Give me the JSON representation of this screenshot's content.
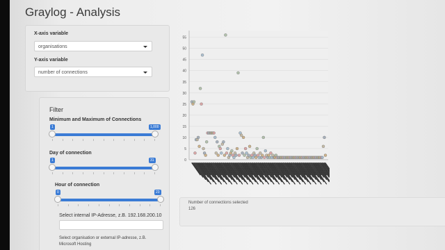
{
  "app": {
    "title": "Graylog - Analysis"
  },
  "axes_panel": {
    "x_label": "X-axis variable",
    "x_value": "organisations",
    "y_label": "Y-axis variable",
    "y_value": "number of connections"
  },
  "filter": {
    "heading": "Filter",
    "connections": {
      "label": "Minimum and Maximum of Connections",
      "min_badge": "1",
      "max_badge": "1,000",
      "min_fraction": 0.0,
      "max_fraction": 1.0
    },
    "day": {
      "label": "Day of connection",
      "min_badge": "1",
      "max_badge": "31",
      "min_fraction": 0.0,
      "max_fraction": 1.0
    },
    "hour": {
      "label": "Hour of connection",
      "min_badge": "0",
      "max_badge": "23",
      "min_fraction": 0.0,
      "max_fraction": 1.0
    },
    "ip_label": "Select internal IP-Adresse, z.B. 192.168.200.10",
    "org_label": "Select organisation or external IP-adresse, z.B. Microsoft Hosting"
  },
  "summary": {
    "label": "Number of connections selected",
    "count": "126"
  },
  "chart_data": {
    "type": "scatter",
    "ylim": [
      0,
      58
    ],
    "yticks": [
      "0",
      "5",
      "10",
      "15",
      "20",
      "25",
      "30",
      "35",
      "40",
      "45",
      "50",
      "55"
    ],
    "grid": true,
    "points": [
      {
        "x": 1,
        "y": 26
      },
      {
        "x": 2,
        "y": 25
      },
      {
        "x": 3,
        "y": 26
      },
      {
        "x": 2,
        "y": 3
      },
      {
        "x": 4,
        "y": 9
      },
      {
        "x": 5,
        "y": 9
      },
      {
        "x": 6,
        "y": 10
      },
      {
        "x": 7,
        "y": 6
      },
      {
        "x": 8,
        "y": 32
      },
      {
        "x": 8,
        "y": 25
      },
      {
        "x": 9,
        "y": 47
      },
      {
        "x": 10,
        "y": 5
      },
      {
        "x": 11,
        "y": 3
      },
      {
        "x": 12,
        "y": 2
      },
      {
        "x": 13,
        "y": 8
      },
      {
        "x": 14,
        "y": 12
      },
      {
        "x": 15,
        "y": 12
      },
      {
        "x": 16,
        "y": 12
      },
      {
        "x": 17,
        "y": 12
      },
      {
        "x": 18,
        "y": 12
      },
      {
        "x": 19,
        "y": 12
      },
      {
        "x": 20,
        "y": 12
      },
      {
        "x": 21,
        "y": 10
      },
      {
        "x": 22,
        "y": 3
      },
      {
        "x": 23,
        "y": 8
      },
      {
        "x": 24,
        "y": 2
      },
      {
        "x": 25,
        "y": 6
      },
      {
        "x": 26,
        "y": 5
      },
      {
        "x": 27,
        "y": 3
      },
      {
        "x": 28,
        "y": 7
      },
      {
        "x": 29,
        "y": 8
      },
      {
        "x": 30,
        "y": 2
      },
      {
        "x": 31,
        "y": 56
      },
      {
        "x": 32,
        "y": 3
      },
      {
        "x": 33,
        "y": 5
      },
      {
        "x": 34,
        "y": 1
      },
      {
        "x": 35,
        "y": 2
      },
      {
        "x": 36,
        "y": 3
      },
      {
        "x": 37,
        "y": 4
      },
      {
        "x": 38,
        "y": 2
      },
      {
        "x": 39,
        "y": 1
      },
      {
        "x": 40,
        "y": 3
      },
      {
        "x": 41,
        "y": 2
      },
      {
        "x": 42,
        "y": 5
      },
      {
        "x": 43,
        "y": 39
      },
      {
        "x": 44,
        "y": 2
      },
      {
        "x": 45,
        "y": 12
      },
      {
        "x": 46,
        "y": 11
      },
      {
        "x": 47,
        "y": 3
      },
      {
        "x": 48,
        "y": 10
      },
      {
        "x": 49,
        "y": 2
      },
      {
        "x": 50,
        "y": 5
      },
      {
        "x": 51,
        "y": 3
      },
      {
        "x": 52,
        "y": 1
      },
      {
        "x": 53,
        "y": 2
      },
      {
        "x": 54,
        "y": 6
      },
      {
        "x": 55,
        "y": 1
      },
      {
        "x": 56,
        "y": 2
      },
      {
        "x": 57,
        "y": 1
      },
      {
        "x": 58,
        "y": 3
      },
      {
        "x": 59,
        "y": 2
      },
      {
        "x": 60,
        "y": 1
      },
      {
        "x": 61,
        "y": 5
      },
      {
        "x": 62,
        "y": 2
      },
      {
        "x": 63,
        "y": 1
      },
      {
        "x": 64,
        "y": 3
      },
      {
        "x": 65,
        "y": 1
      },
      {
        "x": 66,
        "y": 2
      },
      {
        "x": 67,
        "y": 10
      },
      {
        "x": 68,
        "y": 1
      },
      {
        "x": 69,
        "y": 4
      },
      {
        "x": 70,
        "y": 2
      },
      {
        "x": 71,
        "y": 1
      },
      {
        "x": 72,
        "y": 2
      },
      {
        "x": 73,
        "y": 1
      },
      {
        "x": 74,
        "y": 3
      },
      {
        "x": 75,
        "y": 1
      },
      {
        "x": 76,
        "y": 2
      },
      {
        "x": 77,
        "y": 1
      },
      {
        "x": 78,
        "y": 1
      },
      {
        "x": 79,
        "y": 2
      },
      {
        "x": 80,
        "y": 1
      },
      {
        "x": 81,
        "y": 1
      },
      {
        "x": 82,
        "y": 1
      },
      {
        "x": 83,
        "y": 1
      },
      {
        "x": 84,
        "y": 1
      },
      {
        "x": 85,
        "y": 1
      },
      {
        "x": 86,
        "y": 1
      },
      {
        "x": 87,
        "y": 1
      },
      {
        "x": 88,
        "y": 1
      },
      {
        "x": 89,
        "y": 1
      },
      {
        "x": 90,
        "y": 1
      },
      {
        "x": 91,
        "y": 1
      },
      {
        "x": 92,
        "y": 1
      },
      {
        "x": 93,
        "y": 1
      },
      {
        "x": 94,
        "y": 1
      },
      {
        "x": 95,
        "y": 1
      },
      {
        "x": 96,
        "y": 1
      },
      {
        "x": 97,
        "y": 1
      },
      {
        "x": 98,
        "y": 1
      },
      {
        "x": 99,
        "y": 1
      },
      {
        "x": 100,
        "y": 1
      },
      {
        "x": 101,
        "y": 1
      },
      {
        "x": 102,
        "y": 1
      },
      {
        "x": 103,
        "y": 1
      },
      {
        "x": 104,
        "y": 1
      },
      {
        "x": 105,
        "y": 1
      },
      {
        "x": 106,
        "y": 1
      },
      {
        "x": 107,
        "y": 1
      },
      {
        "x": 108,
        "y": 1
      },
      {
        "x": 109,
        "y": 1
      },
      {
        "x": 110,
        "y": 1
      },
      {
        "x": 111,
        "y": 1
      },
      {
        "x": 112,
        "y": 1
      },
      {
        "x": 113,
        "y": 1
      },
      {
        "x": 114,
        "y": 1
      },
      {
        "x": 115,
        "y": 1
      },
      {
        "x": 116,
        "y": 1
      },
      {
        "x": 117,
        "y": 1
      },
      {
        "x": 118,
        "y": 1
      },
      {
        "x": 119,
        "y": 1
      },
      {
        "x": 120,
        "y": 1
      },
      {
        "x": 121,
        "y": 1
      },
      {
        "x": 122,
        "y": 1
      },
      {
        "x": 123,
        "y": 1
      },
      {
        "x": 124,
        "y": 6
      },
      {
        "x": 125,
        "y": 10
      },
      {
        "x": 126,
        "y": 2
      }
    ],
    "point_colors": [
      "#9aa6b3",
      "#c8a878",
      "#a7b9a0",
      "#d79a9a",
      "#9db6c9",
      "#bdb29a"
    ]
  }
}
